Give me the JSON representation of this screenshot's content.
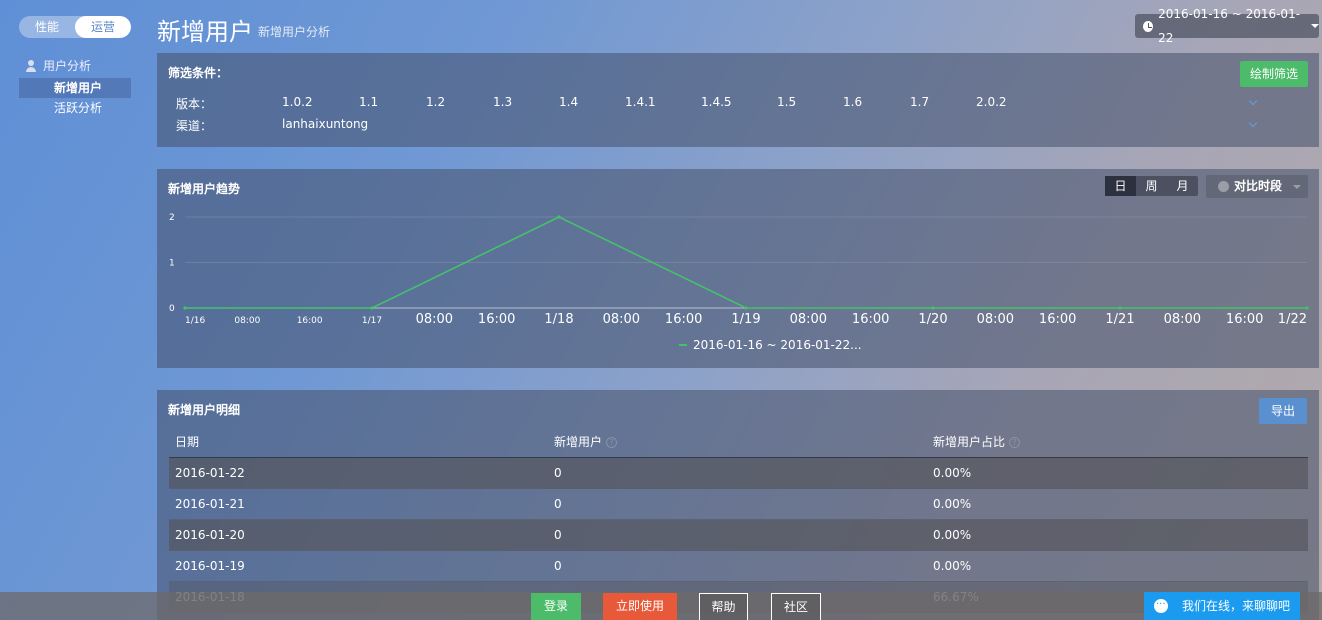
{
  "sidebar": {
    "tabs": [
      "性能",
      "运营"
    ],
    "group_label": "用户分析",
    "items": [
      {
        "label": "新增用户",
        "active": true
      },
      {
        "label": "活跃分析",
        "active": false
      }
    ]
  },
  "header": {
    "title": "新增用户",
    "subtitle": "新增用户分析",
    "date_range": "2016-01-16 ~ 2016-01-22"
  },
  "filter": {
    "title": "筛选条件：",
    "draw_button": "绘制筛选",
    "version_label": "版本：",
    "versions": [
      "1.0.2",
      "1.1",
      "1.2",
      "1.3",
      "1.4",
      "1.4.1",
      "1.4.5",
      "1.5",
      "1.6",
      "1.7",
      "2.0.2"
    ],
    "channel_label": "渠道：",
    "channels": [
      "lanhaixuntong"
    ]
  },
  "trend": {
    "title": "新增用户趋势",
    "period_tabs": [
      "日",
      "周",
      "月"
    ],
    "active_period": "日",
    "compare_label": "对比时段",
    "legend": "2016-01-16 ~ 2016-01-22..."
  },
  "chart_data": {
    "type": "line",
    "x_ticks": [
      "1/16",
      "08:00",
      "16:00",
      "1/17",
      "08:00",
      "16:00",
      "1/18",
      "08:00",
      "16:00",
      "1/19",
      "08:00",
      "16:00",
      "1/20",
      "08:00",
      "16:00",
      "1/21",
      "08:00",
      "16:00",
      "1/22"
    ],
    "y_ticks": [
      0,
      1,
      2
    ],
    "ylim": [
      0,
      2
    ],
    "series": [
      {
        "name": "2016-01-16 ~ 2016-01-22...",
        "color": "#43c26a",
        "x": [
          "1/16",
          "1/17",
          "1/18",
          "1/19",
          "1/20",
          "1/21",
          "1/22"
        ],
        "values": [
          0,
          0,
          2,
          0,
          0,
          0,
          0
        ]
      }
    ]
  },
  "detail": {
    "title": "新增用户明细",
    "export_button": "导出",
    "columns": [
      "日期",
      "新增用户",
      "新增用户占比"
    ],
    "rows": [
      [
        "2016-01-22",
        "0",
        "0.00%"
      ],
      [
        "2016-01-21",
        "0",
        "0.00%"
      ],
      [
        "2016-01-20",
        "0",
        "0.00%"
      ],
      [
        "2016-01-19",
        "0",
        "0.00%"
      ],
      [
        "2016-01-18",
        "",
        "66.67%"
      ]
    ]
  },
  "bottom": {
    "login": "登录",
    "use_now": "立即使用",
    "help": "帮助",
    "community": "社区",
    "chat": "我们在线，来聊聊吧"
  }
}
